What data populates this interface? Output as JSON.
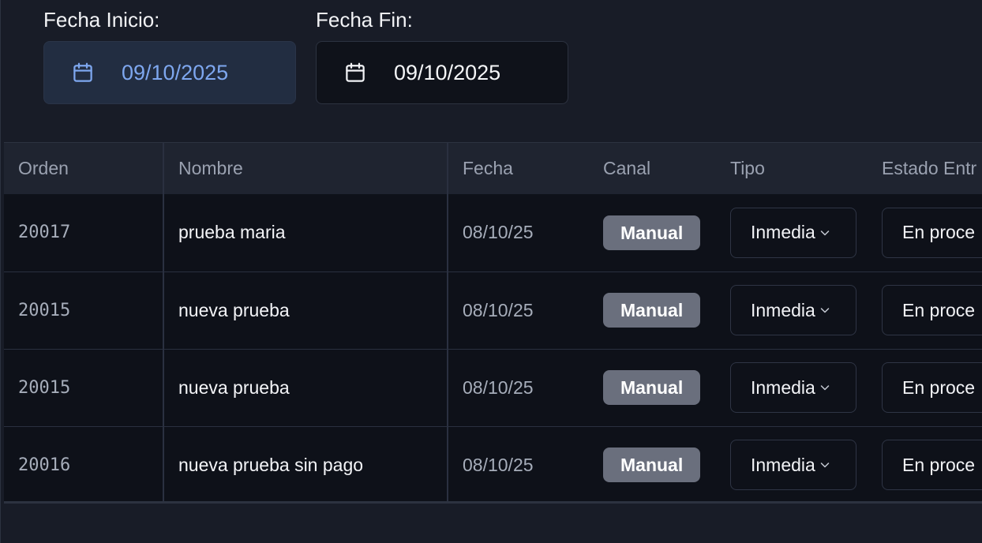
{
  "filters": {
    "start": {
      "label": "Fecha Inicio:",
      "value": "09/10/2025",
      "icon": "calendar-icon"
    },
    "end": {
      "label": "Fecha Fin:",
      "value": "09/10/2025",
      "icon": "calendar-icon"
    }
  },
  "table": {
    "headers": {
      "orden": "Orden",
      "nombre": "Nombre",
      "fecha": "Fecha",
      "canal": "Canal",
      "tipo": "Tipo",
      "estado": "Estado Entr"
    },
    "rows": [
      {
        "orden": "20017",
        "nombre": "prueba maria",
        "fecha": "08/10/25",
        "canal": "Manual",
        "tipo": "Inmedia",
        "estado": "En proce"
      },
      {
        "orden": "20015",
        "nombre": "nueva prueba",
        "fecha": "08/10/25",
        "canal": "Manual",
        "tipo": "Inmedia",
        "estado": "En proce"
      },
      {
        "orden": "20015",
        "nombre": "nueva prueba",
        "fecha": "08/10/25",
        "canal": "Manual",
        "tipo": "Inmedia",
        "estado": "En proce"
      },
      {
        "orden": "20016",
        "nombre": "nueva prueba sin pago",
        "fecha": "08/10/25",
        "canal": "Manual",
        "tipo": "Inmedia",
        "estado": "En proce"
      }
    ]
  },
  "colors": {
    "background": "#181c27",
    "row_background": "#0e1119",
    "header_background": "#1f2430",
    "accent": "#7ea7ef",
    "badge": "#6a6f7d"
  }
}
